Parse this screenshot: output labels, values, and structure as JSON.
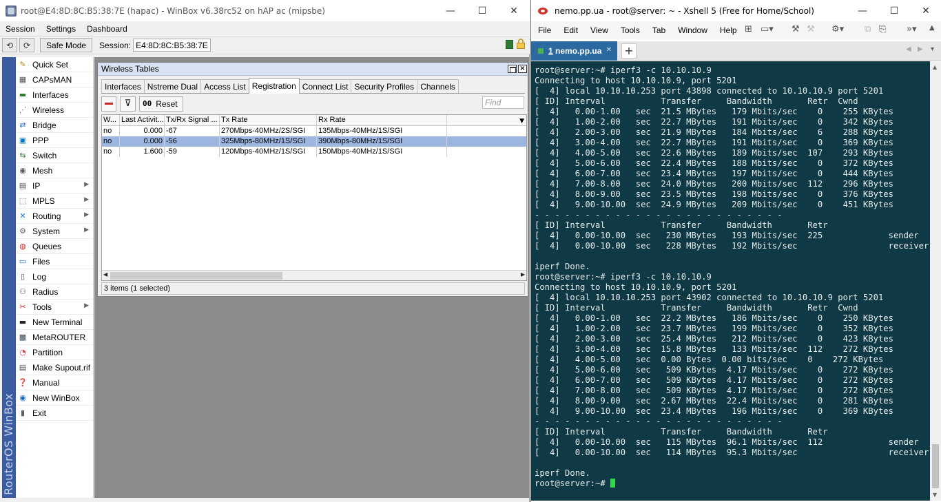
{
  "winbox": {
    "title": "root@E4:8D:8C:B5:38:7E (hapac) - WinBox v6.38rc52 on hAP ac (mipsbe)",
    "window_controls": {
      "minimize": "—",
      "maximize": "☐",
      "close": "✕"
    },
    "menu": [
      "Session",
      "Settings",
      "Dashboard"
    ],
    "toolbar": {
      "undo_icon": "⟲",
      "redo_icon": "⟳",
      "safe_mode_label": "Safe Mode",
      "session_label": "Session:",
      "session_value": "E4:8D:8C:B5:38:7E"
    },
    "sidebar_brand": "RouterOS WinBox",
    "sidebar": [
      {
        "label": "Quick Set",
        "glyph": "✎",
        "color": "#b8860b",
        "submenu": false
      },
      {
        "label": "CAPsMAN",
        "glyph": "▦",
        "color": "#555555",
        "submenu": false
      },
      {
        "label": "Interfaces",
        "glyph": "▬",
        "color": "#2e7d32",
        "submenu": false
      },
      {
        "label": "Wireless",
        "glyph": "⋰",
        "color": "#555555",
        "submenu": false
      },
      {
        "label": "Bridge",
        "glyph": "⇄",
        "color": "#1565c0",
        "submenu": false
      },
      {
        "label": "PPP",
        "glyph": "▣",
        "color": "#0277bd",
        "submenu": false
      },
      {
        "label": "Switch",
        "glyph": "⇆",
        "color": "#2e7d32",
        "submenu": false
      },
      {
        "label": "Mesh",
        "glyph": "◉",
        "color": "#555555",
        "submenu": false
      },
      {
        "label": "IP",
        "glyph": "▤",
        "color": "#555555",
        "submenu": true
      },
      {
        "label": "MPLS",
        "glyph": "⬚",
        "color": "#555555",
        "submenu": true
      },
      {
        "label": "Routing",
        "glyph": "✕",
        "color": "#1976d2",
        "submenu": true
      },
      {
        "label": "System",
        "glyph": "⚙",
        "color": "#616161",
        "submenu": true
      },
      {
        "label": "Queues",
        "glyph": "◍",
        "color": "#c62828",
        "submenu": false
      },
      {
        "label": "Files",
        "glyph": "▭",
        "color": "#1565c0",
        "submenu": false
      },
      {
        "label": "Log",
        "glyph": "▯",
        "color": "#555555",
        "submenu": false
      },
      {
        "label": "Radius",
        "glyph": "⚇",
        "color": "#555555",
        "submenu": false
      },
      {
        "label": "Tools",
        "glyph": "✂",
        "color": "#c62828",
        "submenu": true
      },
      {
        "label": "New Terminal",
        "glyph": "▬",
        "color": "#212121",
        "submenu": false
      },
      {
        "label": "MetaROUTER",
        "glyph": "▩",
        "color": "#37474f",
        "submenu": false
      },
      {
        "label": "Partition",
        "glyph": "◔",
        "color": "#e53935",
        "submenu": false
      },
      {
        "label": "Make Supout.rif",
        "glyph": "▤",
        "color": "#555555",
        "submenu": false
      },
      {
        "label": "Manual",
        "glyph": "❓",
        "color": "#1565c0",
        "submenu": false
      },
      {
        "label": "New WinBox",
        "glyph": "◉",
        "color": "#1565c0",
        "submenu": false
      },
      {
        "label": "Exit",
        "glyph": "▮",
        "color": "#616161",
        "submenu": false
      }
    ],
    "wireless_tables": {
      "title": "Wireless Tables",
      "tabs": [
        "Interfaces",
        "Nstreme Dual",
        "Access List",
        "Registration",
        "Connect List",
        "Security Profiles",
        "Channels"
      ],
      "active_tab": "Registration",
      "reset_label": "Reset",
      "reset_glyph": "00",
      "find_placeholder": "Find",
      "columns": [
        "W...",
        "Last Activit...",
        "Tx/Rx Signal ...",
        "Tx Rate",
        "Rx Rate",
        ""
      ],
      "rows": [
        [
          "no",
          "0.000",
          "-67",
          "270Mbps-40MHz/2S/SGI",
          "135Mbps-40MHz/1S/SGI",
          ""
        ],
        [
          "no",
          "0.000",
          "-56",
          "325Mbps-80MHz/1S/SGI",
          "390Mbps-80MHz/1S/SGI",
          ""
        ],
        [
          "no",
          "1.600",
          "-59",
          "120Mbps-40MHz/1S/SGI",
          "150Mbps-40MHz/1S/SGI",
          ""
        ]
      ],
      "selected_row": 1,
      "status": "3 items (1 selected)"
    }
  },
  "xshell": {
    "title": "nemo.pp.ua - root@server: ~ - Xshell 5 (Free for Home/School)",
    "window_controls": {
      "minimize": "—",
      "maximize": "☐",
      "close": "✕"
    },
    "menu": [
      "File",
      "Edit",
      "View",
      "Tools",
      "Tab",
      "Window",
      "Help"
    ],
    "tab": {
      "number": "1",
      "label": "nemo.pp.ua",
      "close": "✕"
    },
    "new_tab": "+",
    "terminal_lines": [
      "root@server:~# iperf3 -c 10.10.10.9",
      "Connecting to host 10.10.10.9, port 5201",
      "[  4] local 10.10.10.253 port 43898 connected to 10.10.10.9 port 5201",
      "[ ID] Interval           Transfer     Bandwidth       Retr  Cwnd",
      "[  4]   0.00-1.00   sec  21.5 MBytes   179 Mbits/sec    0    255 KBytes",
      "[  4]   1.00-2.00   sec  22.7 MBytes   191 Mbits/sec    0    342 KBytes",
      "[  4]   2.00-3.00   sec  21.9 MBytes   184 Mbits/sec    6    288 KBytes",
      "[  4]   3.00-4.00   sec  22.7 MBytes   191 Mbits/sec    0    369 KBytes",
      "[  4]   4.00-5.00   sec  22.6 MBytes   189 Mbits/sec  107    293 KBytes",
      "[  4]   5.00-6.00   sec  22.4 MBytes   188 Mbits/sec    0    372 KBytes",
      "[  4]   6.00-7.00   sec  23.4 MBytes   197 Mbits/sec    0    444 KBytes",
      "[  4]   7.00-8.00   sec  24.0 MBytes   200 Mbits/sec  112    296 KBytes",
      "[  4]   8.00-9.00   sec  23.5 MBytes   198 Mbits/sec    0    376 KBytes",
      "[  4]   9.00-10.00  sec  24.9 MBytes   209 Mbits/sec    0    451 KBytes",
      "- - - - - - - - - - - - - - - - - - - - - - - - -",
      "[ ID] Interval           Transfer     Bandwidth       Retr",
      "[  4]   0.00-10.00  sec   230 MBytes   193 Mbits/sec  225             sender",
      "[  4]   0.00-10.00  sec   228 MBytes   192 Mbits/sec                  receiver",
      "",
      "iperf Done.",
      "root@server:~# iperf3 -c 10.10.10.9",
      "Connecting to host 10.10.10.9, port 5201",
      "[  4] local 10.10.10.253 port 43902 connected to 10.10.10.9 port 5201",
      "[ ID] Interval           Transfer     Bandwidth       Retr  Cwnd",
      "[  4]   0.00-1.00   sec  22.2 MBytes   186 Mbits/sec    0    250 KBytes",
      "[  4]   1.00-2.00   sec  23.7 MBytes   199 Mbits/sec    0    352 KBytes",
      "[  4]   2.00-3.00   sec  25.4 MBytes   212 Mbits/sec    0    423 KBytes",
      "[  4]   3.00-4.00   sec  15.8 MBytes   133 Mbits/sec  112    272 KBytes",
      "[  4]   4.00-5.00   sec  0.00 Bytes  0.00 bits/sec    0    272 KBytes",
      "[  4]   5.00-6.00   sec   509 KBytes  4.17 Mbits/sec    0    272 KBytes",
      "[  4]   6.00-7.00   sec   509 KBytes  4.17 Mbits/sec    0    272 KBytes",
      "[  4]   7.00-8.00   sec   509 KBytes  4.17 Mbits/sec    0    272 KBytes",
      "[  4]   8.00-9.00   sec  2.67 MBytes  22.4 Mbits/sec    0    281 KBytes",
      "[  4]   9.00-10.00  sec  23.4 MBytes   196 Mbits/sec    0    369 KBytes",
      "- - - - - - - - - - - - - - - - - - - - - - - - -",
      "[ ID] Interval           Transfer     Bandwidth       Retr",
      "[  4]   0.00-10.00  sec   115 MBytes  96.1 Mbits/sec  112             sender",
      "[  4]   0.00-10.00  sec   114 MBytes  95.3 Mbits/sec                  receiver",
      "",
      "iperf Done.",
      "root@server:~# "
    ]
  }
}
